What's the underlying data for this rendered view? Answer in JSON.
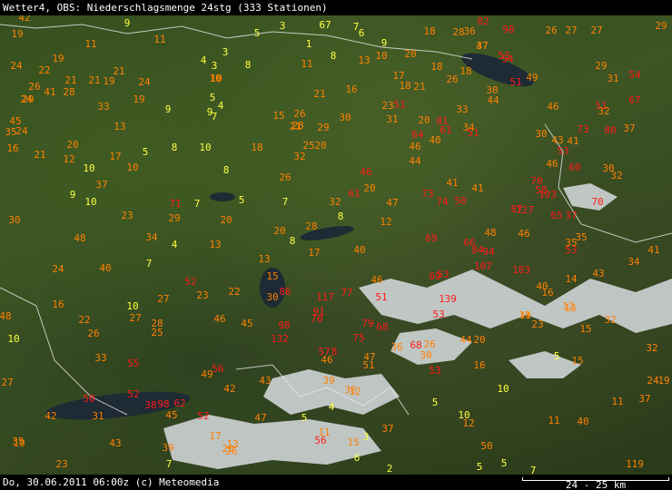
{
  "header": {
    "title": "Wetter4, OBS: Niederschlagsmenge 24stg (333 Stationen)"
  },
  "footer": {
    "text": "Do, 30.06.2011 06:00z (c) Meteomedia",
    "scale": "24 - 25 km"
  },
  "colors": {
    "low": "#ffff40",
    "mid": "#ff8000",
    "high": "#ff1a1a"
  },
  "stations": [
    {
      "v": "42",
      "c": "mid"
    },
    {
      "v": "9",
      "c": "low"
    },
    {
      "v": "19",
      "c": "mid"
    },
    {
      "v": "11",
      "c": "mid"
    },
    {
      "v": "11",
      "c": "mid"
    },
    {
      "v": "5",
      "c": "low"
    },
    {
      "v": "3",
      "c": "low"
    },
    {
      "v": "67",
      "c": "low"
    },
    {
      "v": "7",
      "c": "low"
    },
    {
      "v": "6",
      "c": "low"
    },
    {
      "v": "1",
      "c": "low"
    },
    {
      "v": "9",
      "c": "low"
    },
    {
      "v": "18",
      "c": "mid"
    },
    {
      "v": "28",
      "c": "mid"
    },
    {
      "v": "36",
      "c": "mid"
    },
    {
      "v": "37",
      "c": "mid"
    },
    {
      "v": "82",
      "c": "high"
    },
    {
      "v": "98",
      "c": "high"
    },
    {
      "v": "26",
      "c": "mid"
    },
    {
      "v": "27",
      "c": "mid"
    },
    {
      "v": "27",
      "c": "mid"
    },
    {
      "v": "29",
      "c": "mid"
    },
    {
      "v": "19",
      "c": "mid"
    },
    {
      "v": "3",
      "c": "low"
    },
    {
      "v": "8",
      "c": "low"
    },
    {
      "v": "8",
      "c": "low"
    },
    {
      "v": "4",
      "c": "low"
    },
    {
      "v": "3",
      "c": "low"
    },
    {
      "v": "10",
      "c": "mid"
    },
    {
      "v": "13",
      "c": "mid"
    },
    {
      "v": "10",
      "c": "mid"
    },
    {
      "v": "20",
      "c": "mid"
    },
    {
      "v": "47",
      "c": "mid"
    },
    {
      "v": "53",
      "c": "high"
    },
    {
      "v": "54",
      "c": "high"
    },
    {
      "v": "24",
      "c": "mid"
    },
    {
      "v": "22",
      "c": "mid"
    },
    {
      "v": "21",
      "c": "mid"
    },
    {
      "v": "24",
      "c": "mid"
    },
    {
      "v": "11",
      "c": "mid"
    },
    {
      "v": "21",
      "c": "mid"
    },
    {
      "v": "17",
      "c": "mid"
    },
    {
      "v": "18",
      "c": "mid"
    },
    {
      "v": "18",
      "c": "mid"
    },
    {
      "v": "29",
      "c": "mid"
    },
    {
      "v": "54",
      "c": "high"
    },
    {
      "v": "26",
      "c": "mid"
    },
    {
      "v": "41",
      "c": "mid"
    },
    {
      "v": "28",
      "c": "mid"
    },
    {
      "v": "21",
      "c": "mid"
    },
    {
      "v": "19",
      "c": "mid"
    },
    {
      "v": "24",
      "c": "mid"
    },
    {
      "v": "10",
      "c": "mid"
    },
    {
      "v": "16",
      "c": "mid"
    },
    {
      "v": "18",
      "c": "mid"
    },
    {
      "v": "21",
      "c": "mid"
    },
    {
      "v": "26",
      "c": "mid"
    },
    {
      "v": "51",
      "c": "high"
    },
    {
      "v": "49",
      "c": "mid"
    },
    {
      "v": "31",
      "c": "mid"
    },
    {
      "v": "29",
      "c": "mid"
    },
    {
      "v": "19",
      "c": "mid"
    },
    {
      "v": "5",
      "c": "low"
    },
    {
      "v": "4",
      "c": "low"
    },
    {
      "v": "21",
      "c": "mid"
    },
    {
      "v": "30",
      "c": "mid"
    },
    {
      "v": "44",
      "c": "mid"
    },
    {
      "v": "67",
      "c": "high"
    },
    {
      "v": "33",
      "c": "mid"
    },
    {
      "v": "9",
      "c": "low"
    },
    {
      "v": "9",
      "c": "low"
    },
    {
      "v": "7",
      "c": "low"
    },
    {
      "v": "15",
      "c": "mid"
    },
    {
      "v": "26",
      "c": "mid"
    },
    {
      "v": "28",
      "c": "mid"
    },
    {
      "v": "23",
      "c": "mid"
    },
    {
      "v": "51",
      "c": "high"
    },
    {
      "v": "33",
      "c": "mid"
    },
    {
      "v": "46",
      "c": "mid"
    },
    {
      "v": "51",
      "c": "high"
    },
    {
      "v": "32",
      "c": "mid"
    },
    {
      "v": "45",
      "c": "mid"
    },
    {
      "v": "35",
      "c": "mid"
    },
    {
      "v": "13",
      "c": "mid"
    },
    {
      "v": "21",
      "c": "mid"
    },
    {
      "v": "29",
      "c": "mid"
    },
    {
      "v": "30",
      "c": "mid"
    },
    {
      "v": "31",
      "c": "mid"
    },
    {
      "v": "20",
      "c": "mid"
    },
    {
      "v": "81",
      "c": "high"
    },
    {
      "v": "61",
      "c": "high"
    },
    {
      "v": "37",
      "c": "mid"
    },
    {
      "v": "34",
      "c": "mid"
    },
    {
      "v": "30",
      "c": "mid"
    },
    {
      "v": "43",
      "c": "mid"
    },
    {
      "v": "41",
      "c": "mid"
    },
    {
      "v": "73",
      "c": "high"
    },
    {
      "v": "80",
      "c": "high"
    },
    {
      "v": "20",
      "c": "mid"
    },
    {
      "v": "24",
      "c": "mid"
    },
    {
      "v": "21",
      "c": "mid"
    },
    {
      "v": "16",
      "c": "mid"
    },
    {
      "v": "5",
      "c": "low"
    },
    {
      "v": "8",
      "c": "low"
    },
    {
      "v": "10",
      "c": "low"
    },
    {
      "v": "18",
      "c": "mid"
    },
    {
      "v": "25",
      "c": "mid"
    },
    {
      "v": "20",
      "c": "mid"
    },
    {
      "v": "32",
      "c": "mid"
    },
    {
      "v": "64",
      "c": "high"
    },
    {
      "v": "46",
      "c": "mid"
    },
    {
      "v": "40",
      "c": "mid"
    },
    {
      "v": "51",
      "c": "high"
    },
    {
      "v": "44",
      "c": "mid"
    },
    {
      "v": "53",
      "c": "high"
    },
    {
      "v": "12",
      "c": "mid"
    },
    {
      "v": "17",
      "c": "mid"
    },
    {
      "v": "10",
      "c": "mid"
    },
    {
      "v": "10",
      "c": "low"
    },
    {
      "v": "8",
      "c": "low"
    },
    {
      "v": "26",
      "c": "mid"
    },
    {
      "v": "46",
      "c": "high"
    },
    {
      "v": "46",
      "c": "mid"
    },
    {
      "v": "60",
      "c": "high"
    },
    {
      "v": "30",
      "c": "mid"
    },
    {
      "v": "32",
      "c": "mid"
    },
    {
      "v": "37",
      "c": "mid"
    },
    {
      "v": "9",
      "c": "low"
    },
    {
      "v": "10",
      "c": "low"
    },
    {
      "v": "23",
      "c": "mid"
    },
    {
      "v": "20",
      "c": "mid"
    },
    {
      "v": "61",
      "c": "high"
    },
    {
      "v": "73",
      "c": "high"
    },
    {
      "v": "41",
      "c": "mid"
    },
    {
      "v": "41",
      "c": "mid"
    },
    {
      "v": "70",
      "c": "high"
    },
    {
      "v": "58",
      "c": "high"
    },
    {
      "v": "103",
      "c": "high"
    },
    {
      "v": "71",
      "c": "high"
    },
    {
      "v": "7",
      "c": "low"
    },
    {
      "v": "5",
      "c": "low"
    },
    {
      "v": "7",
      "c": "low"
    },
    {
      "v": "32",
      "c": "mid"
    },
    {
      "v": "47",
      "c": "mid"
    },
    {
      "v": "74",
      "c": "high"
    },
    {
      "v": "50",
      "c": "high"
    },
    {
      "v": "70",
      "c": "high"
    },
    {
      "v": "30",
      "c": "mid"
    },
    {
      "v": "29",
      "c": "mid"
    },
    {
      "v": "20",
      "c": "mid"
    },
    {
      "v": "8",
      "c": "low"
    },
    {
      "v": "12",
      "c": "mid"
    },
    {
      "v": "87",
      "c": "high"
    },
    {
      "v": "127",
      "c": "high"
    },
    {
      "v": "65",
      "c": "high"
    },
    {
      "v": "37",
      "c": "high"
    },
    {
      "v": "48",
      "c": "mid"
    },
    {
      "v": "34",
      "c": "mid"
    },
    {
      "v": "4",
      "c": "low"
    },
    {
      "v": "13",
      "c": "mid"
    },
    {
      "v": "20",
      "c": "mid"
    },
    {
      "v": "8",
      "c": "low"
    },
    {
      "v": "28",
      "c": "mid"
    },
    {
      "v": "48",
      "c": "mid"
    },
    {
      "v": "69",
      "c": "high"
    },
    {
      "v": "66",
      "c": "high"
    },
    {
      "v": "84",
      "c": "high"
    },
    {
      "v": "94",
      "c": "high"
    },
    {
      "v": "46",
      "c": "mid"
    },
    {
      "v": "35",
      "c": "mid"
    },
    {
      "v": "35",
      "c": "mid"
    },
    {
      "v": "53",
      "c": "high"
    },
    {
      "v": "41",
      "c": "mid"
    },
    {
      "v": "24",
      "c": "mid"
    },
    {
      "v": "40",
      "c": "mid"
    },
    {
      "v": "7",
      "c": "low"
    },
    {
      "v": "13",
      "c": "mid"
    },
    {
      "v": "17",
      "c": "mid"
    },
    {
      "v": "40",
      "c": "mid"
    },
    {
      "v": "107",
      "c": "high"
    },
    {
      "v": "103",
      "c": "high"
    },
    {
      "v": "34",
      "c": "mid"
    },
    {
      "v": "15",
      "c": "mid"
    },
    {
      "v": "69",
      "c": "high"
    },
    {
      "v": "53",
      "c": "high"
    },
    {
      "v": "46",
      "c": "mid"
    },
    {
      "v": "43",
      "c": "mid"
    },
    {
      "v": "52",
      "c": "high"
    },
    {
      "v": "40",
      "c": "mid"
    },
    {
      "v": "16",
      "c": "mid"
    },
    {
      "v": "14",
      "c": "mid"
    },
    {
      "v": "16",
      "c": "mid"
    },
    {
      "v": "10",
      "c": "low"
    },
    {
      "v": "27",
      "c": "mid"
    },
    {
      "v": "23",
      "c": "mid"
    },
    {
      "v": "22",
      "c": "mid"
    },
    {
      "v": "30",
      "c": "mid"
    },
    {
      "v": "86",
      "c": "high"
    },
    {
      "v": "117",
      "c": "high"
    },
    {
      "v": "77",
      "c": "high"
    },
    {
      "v": "51",
      "c": "high"
    },
    {
      "v": "139",
      "c": "high"
    },
    {
      "v": "30",
      "c": "mid"
    },
    {
      "v": "12",
      "c": "mid"
    },
    {
      "v": "13",
      "c": "mid"
    },
    {
      "v": "48",
      "c": "mid"
    },
    {
      "v": "22",
      "c": "mid"
    },
    {
      "v": "27",
      "c": "mid"
    },
    {
      "v": "46",
      "c": "mid"
    },
    {
      "v": "45",
      "c": "mid"
    },
    {
      "v": "91",
      "c": "high"
    },
    {
      "v": "70",
      "c": "high"
    },
    {
      "v": "53",
      "c": "high"
    },
    {
      "v": "11",
      "c": "mid"
    },
    {
      "v": "23",
      "c": "mid"
    },
    {
      "v": "15",
      "c": "mid"
    },
    {
      "v": "32",
      "c": "mid"
    },
    {
      "v": "10",
      "c": "low"
    },
    {
      "v": "26",
      "c": "mid"
    },
    {
      "v": "28",
      "c": "mid"
    },
    {
      "v": "25",
      "c": "mid"
    },
    {
      "v": "98",
      "c": "high"
    },
    {
      "v": "79",
      "c": "high"
    },
    {
      "v": "68",
      "c": "high"
    },
    {
      "v": "132",
      "c": "high"
    },
    {
      "v": "75",
      "c": "high"
    },
    {
      "v": "36",
      "c": "mid"
    },
    {
      "v": "68",
      "c": "high"
    },
    {
      "v": "26",
      "c": "mid"
    },
    {
      "v": "44",
      "c": "mid"
    },
    {
      "v": "20",
      "c": "mid"
    },
    {
      "v": "32",
      "c": "mid"
    },
    {
      "v": "33",
      "c": "mid"
    },
    {
      "v": "55",
      "c": "high"
    },
    {
      "v": "57",
      "c": "high"
    },
    {
      "v": "8",
      "c": "high"
    },
    {
      "v": "46",
      "c": "mid"
    },
    {
      "v": "47",
      "c": "mid"
    },
    {
      "v": "51",
      "c": "mid"
    },
    {
      "v": "30",
      "c": "mid"
    },
    {
      "v": "5",
      "c": "low"
    },
    {
      "v": "15",
      "c": "mid"
    },
    {
      "v": "27",
      "c": "mid"
    },
    {
      "v": "49",
      "c": "mid"
    },
    {
      "v": "56",
      "c": "high"
    },
    {
      "v": "43",
      "c": "mid"
    },
    {
      "v": "39",
      "c": "mid"
    },
    {
      "v": "53",
      "c": "high"
    },
    {
      "v": "16",
      "c": "mid"
    },
    {
      "v": "24",
      "c": "mid"
    },
    {
      "v": "19",
      "c": "mid"
    },
    {
      "v": "50",
      "c": "high"
    },
    {
      "v": "52",
      "c": "high"
    },
    {
      "v": "42",
      "c": "mid"
    },
    {
      "v": "38",
      "c": "high"
    },
    {
      "v": "98",
      "c": "high"
    },
    {
      "v": "62",
      "c": "high"
    },
    {
      "v": "36",
      "c": "mid"
    },
    {
      "v": "12",
      "c": "mid"
    },
    {
      "v": "5",
      "c": "low"
    },
    {
      "v": "10",
      "c": "low"
    },
    {
      "v": "11",
      "c": "mid"
    },
    {
      "v": "37",
      "c": "mid"
    },
    {
      "v": "42",
      "c": "mid"
    },
    {
      "v": "31",
      "c": "mid"
    },
    {
      "v": "45",
      "c": "mid"
    },
    {
      "v": "52",
      "c": "high"
    },
    {
      "v": "47",
      "c": "mid"
    },
    {
      "v": "5",
      "c": "low"
    },
    {
      "v": "4",
      "c": "low"
    },
    {
      "v": "10",
      "c": "low"
    },
    {
      "v": "12",
      "c": "mid"
    },
    {
      "v": "11",
      "c": "mid"
    },
    {
      "v": "40",
      "c": "mid"
    },
    {
      "v": "37",
      "c": "mid"
    },
    {
      "v": "43",
      "c": "mid"
    },
    {
      "v": "17",
      "c": "mid"
    },
    {
      "v": "13",
      "c": "mid"
    },
    {
      "v": "11",
      "c": "mid"
    },
    {
      "v": "56",
      "c": "high"
    },
    {
      "v": "26",
      "c": "mid"
    },
    {
      "v": "35",
      "c": "mid"
    },
    {
      "v": "39",
      "c": "mid"
    },
    {
      "v": "19",
      "c": "mid"
    },
    {
      "v": "20",
      "c": "mid"
    },
    {
      "v": "15",
      "c": "mid"
    },
    {
      "v": "3",
      "c": "low"
    },
    {
      "v": "50",
      "c": "mid"
    },
    {
      "v": "23",
      "c": "mid"
    },
    {
      "v": "7",
      "c": "low"
    },
    {
      "v": "6",
      "c": "low"
    },
    {
      "v": "2",
      "c": "low"
    },
    {
      "v": "5",
      "c": "low"
    },
    {
      "v": "5",
      "c": "low"
    },
    {
      "v": "7",
      "c": "low"
    },
    {
      "v": "119",
      "c": "mid"
    }
  ]
}
